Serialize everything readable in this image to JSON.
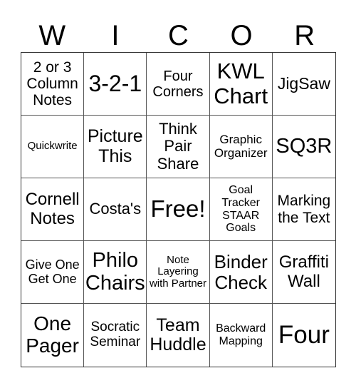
{
  "header": [
    "W",
    "I",
    "C",
    "O",
    "R"
  ],
  "cells": [
    {
      "text": "2 or 3 Column Notes",
      "size": 21
    },
    {
      "text": "3-2-1",
      "size": 32
    },
    {
      "text": "Four Corners",
      "size": 20
    },
    {
      "text": "KWL Chart",
      "size": 31
    },
    {
      "text": "JigSaw",
      "size": 23
    },
    {
      "text": "Quickwrite",
      "size": 15
    },
    {
      "text": "Picture This",
      "size": 25
    },
    {
      "text": "Think Pair Share",
      "size": 22
    },
    {
      "text": "Graphic Organizer",
      "size": 17
    },
    {
      "text": "SQ3R",
      "size": 29
    },
    {
      "text": "Cornell Notes",
      "size": 24
    },
    {
      "text": "Costa's",
      "size": 22
    },
    {
      "text": "Free!",
      "size": 33
    },
    {
      "text": "Goal Tracker STAAR Goals",
      "size": 16
    },
    {
      "text": "Marking the Text",
      "size": 21
    },
    {
      "text": "Give One Get One",
      "size": 18
    },
    {
      "text": "Philo Chairs",
      "size": 29
    },
    {
      "text": "Note Layering with Partner",
      "size": 15
    },
    {
      "text": "Binder Check",
      "size": 26
    },
    {
      "text": "Graffiti Wall",
      "size": 24
    },
    {
      "text": "One Pager",
      "size": 28
    },
    {
      "text": "Socratic Seminar",
      "size": 19
    },
    {
      "text": "Team Huddle",
      "size": 25
    },
    {
      "text": "Backward Mapping",
      "size": 16
    },
    {
      "text": "Four",
      "size": 35
    }
  ]
}
